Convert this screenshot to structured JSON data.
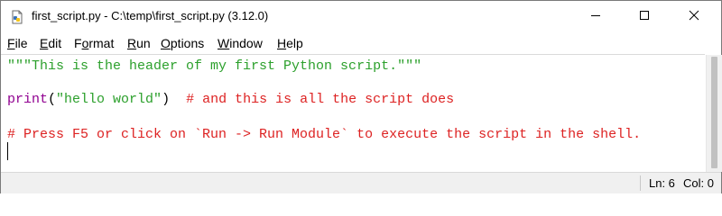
{
  "window": {
    "title": "first_script.py - C:\\temp\\first_script.py (3.12.0)",
    "app_icon": "python-file-icon",
    "controls": [
      "minimize-icon",
      "maximize-icon",
      "close-icon"
    ]
  },
  "menu": {
    "items": [
      {
        "accel": "F",
        "rest": "ile"
      },
      {
        "accel": "E",
        "rest": "dit"
      },
      {
        "pre": "F",
        "accel": "o",
        "rest": "rmat"
      },
      {
        "accel": "R",
        "rest": "un"
      },
      {
        "accel": "O",
        "rest": "ptions"
      },
      {
        "accel": "W",
        "rest": "indow"
      },
      {
        "accel": "H",
        "rest": "elp"
      }
    ]
  },
  "editor": {
    "line1": "\"\"\"This is the header of my first Python script.\"\"\"",
    "line3_func": "print",
    "line3_paren_open": "(",
    "line3_string": "\"hello world\"",
    "line3_paren_close": ")",
    "line3_comment": "  # and this is all the script does",
    "line5": "# Press F5 or click on `Run -> Run Module` to execute the script in the shell."
  },
  "status": {
    "line": "Ln: 6",
    "col": "Col: 0"
  },
  "colors": {
    "string": "#2ca02c",
    "builtin": "#900090",
    "comment": "#dd2222"
  }
}
